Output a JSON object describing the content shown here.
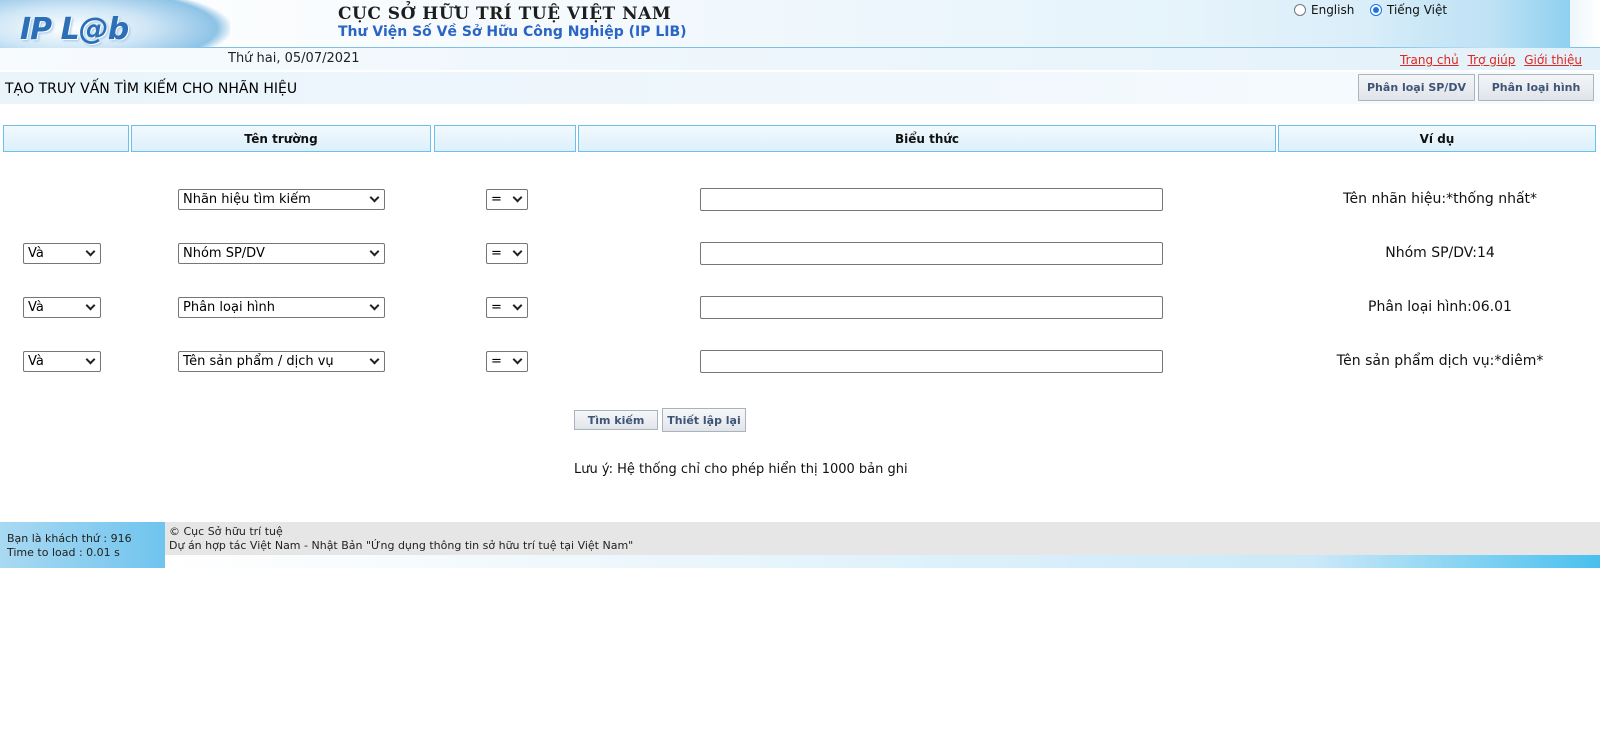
{
  "header": {
    "logo_text": "IP L@b",
    "org_title": "CỤC SỞ HỮU TRÍ TUỆ VIỆT NAM",
    "lib_title": "Thư Viện Số Về Sở Hữu Công Nghiệp (IP LIB)",
    "languages": [
      {
        "label": "English",
        "selected": false
      },
      {
        "label": "Tiếng Việt",
        "selected": true
      }
    ]
  },
  "subbar": {
    "date": "Thứ hai, 05/07/2021",
    "links": [
      "Trang chủ",
      "Trợ giúp",
      "Giới thiệu"
    ]
  },
  "titlebar": {
    "title": "TẠO TRUY VẤN TÌM KIẾM CHO NHÃN HIỆU",
    "buttons": [
      "Phân loại SP/DV",
      "Phân loại hình"
    ]
  },
  "columns": [
    "",
    "Tên trường",
    "",
    "Biểu thức",
    "Ví dụ"
  ],
  "rows": [
    {
      "connector": "",
      "field": "Nhãn hiệu tìm kiếm",
      "operator": "=",
      "expression": "",
      "example": "Tên nhãn hiệu:*thống nhất*"
    },
    {
      "connector": "Và",
      "field": "Nhóm SP/DV",
      "operator": "=",
      "expression": "",
      "example": "Nhóm SP/DV:14"
    },
    {
      "connector": "Và",
      "field": "Phân loại hình",
      "operator": "=",
      "expression": "",
      "example": "Phân loại hình:06.01"
    },
    {
      "connector": "Và",
      "field": "Tên sản phẩm / dịch vụ",
      "operator": "=",
      "expression": "",
      "example": "Tên sản phẩm dịch vụ:*diêm*"
    }
  ],
  "actions": {
    "search_label": "Tìm kiếm",
    "reset_label": "Thiết lập lại"
  },
  "note": "Lưu ý: Hệ thống chỉ cho phép hiển thị 1000 bản ghi",
  "footer": {
    "visitor": "Bạn là khách thứ : 916",
    "load_time": "Time to load : 0.01 s",
    "copyright": "© Cục Sở hữu trí tuệ",
    "project": "Dự án hợp tác Việt Nam - Nhật Bản \"Ứng dụng thông tin sở hữu trí tuệ tại Việt Nam\""
  },
  "colors": {
    "link_red": "#e0261f",
    "title_blue": "#2a64c4",
    "header_border": "#6cc0ea",
    "footer_blue": "#6fc4ee"
  }
}
